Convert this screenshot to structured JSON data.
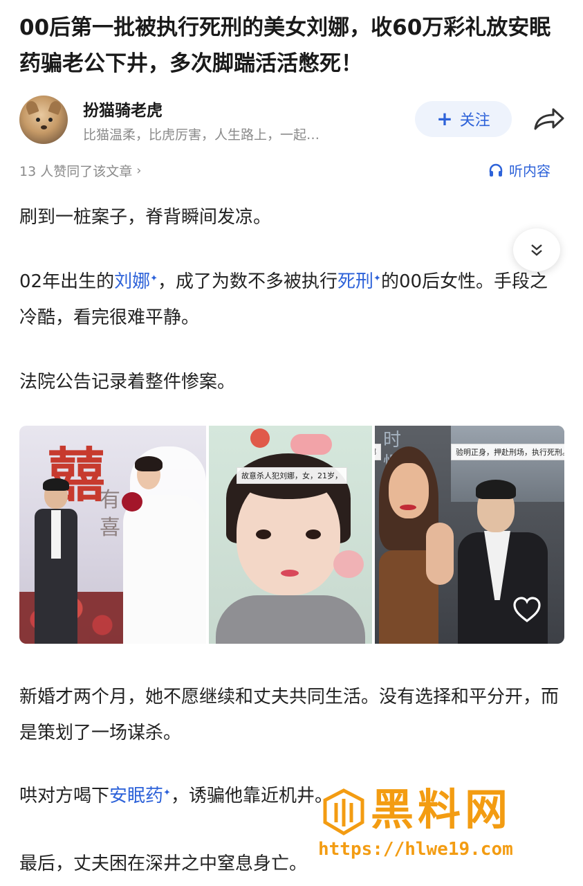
{
  "article": {
    "title": "00后第一批被执行死刑的美女刘娜，收60万彩礼放安眠药骗老公下井，多次脚踹活活憋死！"
  },
  "author": {
    "name": "扮猫骑老虎",
    "bio": "比猫温柔，比虎厉害，人生路上，一起…",
    "follow_label": "关注"
  },
  "meta": {
    "likes_text": "13 人赞同了该文章",
    "listen_label": "听内容"
  },
  "body": {
    "p1": "刷到一桩案子，脊背瞬间发凉。",
    "p2_a": "02年出生的",
    "p2_link1": "刘娜",
    "p2_b": "，成了为数不多被执行",
    "p2_link2": "死刑",
    "p2_c": "的00后女性。手段之冷酷，看完很难平静。",
    "p3": "法院公告记录着整件惨案。",
    "p4": "新婚才两个月，她不愿继续和丈夫共同生活。没有选择和平分开，而是策划了一场谋杀。",
    "p5_a": "哄对方喝下",
    "p5_link": "安眠药",
    "p5_b": "，诱骗他靠近机井。",
    "p6": "最后，丈夫困在深井之中窒息身亡。"
  },
  "images": {
    "img1_text_big": "囍",
    "img1_text_small": "有喜",
    "img2_caption": "故意杀人犯刘娜，女，21岁，",
    "img3_caption1": "待罪犯刘娜",
    "img3_caption2": "验明正身，押赴刑场，执行死刑。",
    "img3_title": "时慢"
  },
  "watermark": {
    "text": "黑料网",
    "url": "https://hlwe19.com"
  },
  "colors": {
    "link": "#2d62d9",
    "accent_orange": "#f39c12",
    "muted": "#8a8a8a"
  }
}
